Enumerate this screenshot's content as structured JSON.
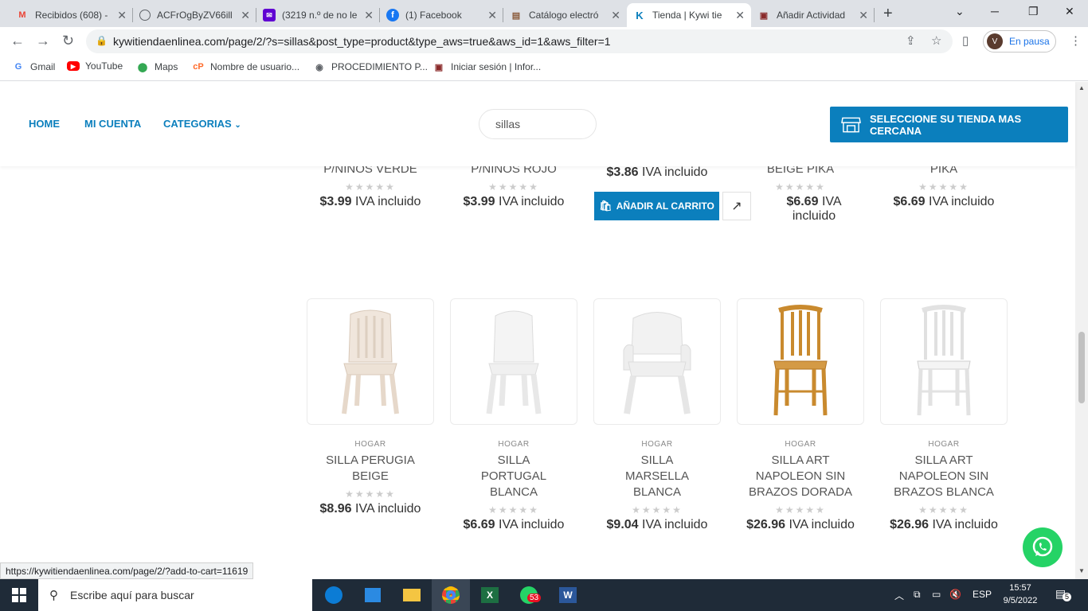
{
  "browser": {
    "tabs": [
      {
        "title": "Recibidos (608) -",
        "favicon": "gmail-icon"
      },
      {
        "title": "ACFrOgByZV66ill",
        "favicon": "globe-icon"
      },
      {
        "title": "(3219 n.º de no le",
        "favicon": "yahoo-mail-icon"
      },
      {
        "title": "(1) Facebook",
        "favicon": "facebook-icon"
      },
      {
        "title": "Catálogo electró",
        "favicon": "catalog-icon"
      },
      {
        "title": "Tienda | Kywi tie",
        "favicon": "kywi-icon",
        "active": true
      },
      {
        "title": "Añadir Actividad",
        "favicon": "activity-icon"
      }
    ],
    "url": "kywitiendaenlinea.com/page/2/?s=sillas&post_type=product&type_aws=true&aws_id=1&aws_filter=1",
    "profile_initial": "V",
    "profile_status": "En pausa",
    "bookmarks": [
      "Gmail",
      "YouTube",
      "Maps",
      "Nombre de usuario...",
      "PROCEDIMIENTO P...",
      "Iniciar sesión | Infor..."
    ]
  },
  "site": {
    "nav": [
      "HOME",
      "MI CUENTA",
      "CATEGORIAS"
    ],
    "search_value": "sillas",
    "store_button": "SELECCIONE SU TIENDA MAS CERCANA"
  },
  "top_row": [
    {
      "name": "P/NINOS VERDE",
      "price": "$3.99",
      "iva": "IVA incluido",
      "rating": 0
    },
    {
      "name": "P/NINOS ROJO",
      "price": "$3.99",
      "iva": "IVA incluido",
      "rating": 0
    },
    {
      "name": "",
      "price": "$3.86",
      "iva": "IVA incluido",
      "rating": 0
    },
    {
      "name": "BEIGE PIKA",
      "price": "$6.69",
      "iva": "IVA incluido",
      "rating": 0
    },
    {
      "name": "PIKA",
      "price": "$6.69",
      "iva": "IVA incluido",
      "rating": 0
    }
  ],
  "add_to_cart": "AÑADIR AL CARRITO",
  "products": [
    {
      "category": "HOGAR",
      "name": "SILLA PERUGIA BEIGE",
      "price": "$8.96",
      "iva": "IVA incluido",
      "rating": 0,
      "color": "#f0e6dc"
    },
    {
      "category": "HOGAR",
      "name": "SILLA PORTUGAL BLANCA",
      "price": "$6.69",
      "iva": "IVA incluido",
      "rating": 0,
      "color": "#f4f4f4"
    },
    {
      "category": "HOGAR",
      "name": "SILLA MARSELLA BLANCA",
      "price": "$9.04",
      "iva": "IVA incluido",
      "rating": 0,
      "color": "#f2f2f2"
    },
    {
      "category": "HOGAR",
      "name": "SILLA ART NAPOLEON SIN BRAZOS DORADA",
      "price": "$26.96",
      "iva": "IVA incluido",
      "rating": 0,
      "color": "#c98a2e"
    },
    {
      "category": "HOGAR",
      "name": "SILLA ART NAPOLEON SIN BRAZOS BLANCA",
      "price": "$26.96",
      "iva": "IVA incluido",
      "rating": 0,
      "color": "#f4f4f4"
    }
  ],
  "status_url": "https://kywitiendaenlinea.com/page/2/?add-to-cart=11619",
  "taskbar": {
    "search_placeholder": "Escribe aquí para buscar",
    "whatsapp_badge": "53",
    "language": "ESP",
    "time": "15:57",
    "date": "9/5/2022",
    "notifications": "5"
  },
  "colors": {
    "brand": "#0b7fbd",
    "whatsapp": "#25d366"
  }
}
